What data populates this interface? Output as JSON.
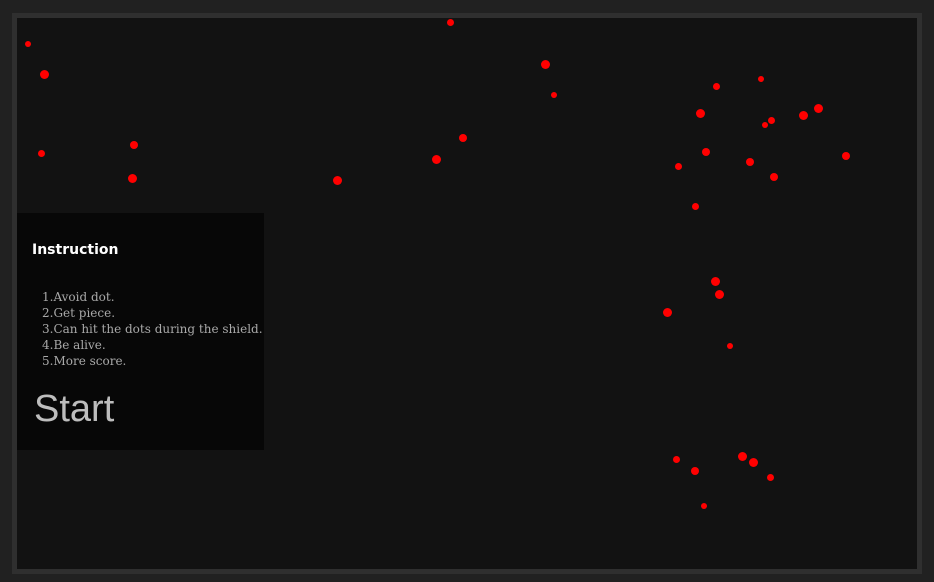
{
  "menu": {
    "title": "Instruction",
    "instructions": [
      "1.Avoid dot.",
      "2.Get piece.",
      "3.Can hit the dots during the shield.",
      "4.Be alive.",
      "5.More score."
    ],
    "start_label": "Start"
  },
  "colors": {
    "dot": "#ff0000",
    "playfield_background": "#121212",
    "panel_background": "#070707",
    "frame_border": "#2f2f2f"
  }
}
